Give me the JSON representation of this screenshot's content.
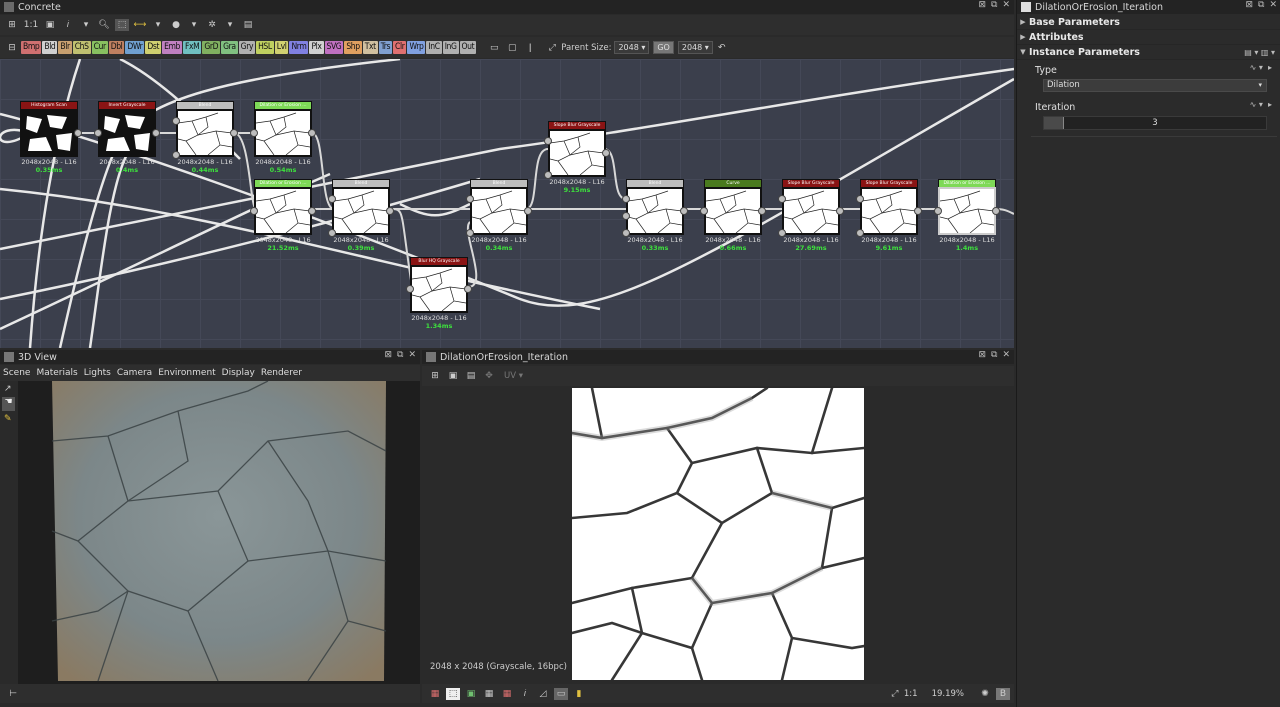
{
  "graph_panel": {
    "title": "Concrete",
    "toolbar": {
      "zoom_label": "1:1"
    },
    "filters": [
      "Bmp",
      "Bld",
      "Blr",
      "ChS",
      "Cur",
      "Dbl",
      "DWr",
      "Dst",
      "Emb",
      "FxM",
      "GrD",
      "Gra",
      "Gry",
      "HSL",
      "Lvl",
      "Nrm",
      "Plx",
      "SVG",
      "Shp",
      "Txt",
      "Trs",
      "Clr",
      "Wrp",
      "InC",
      "InG",
      "Out"
    ],
    "filter_colors": [
      "#d07070",
      "#d0d0d0",
      "#c8a070",
      "#c0c070",
      "#88c060",
      "#c08060",
      "#70a0d0",
      "#d0d070",
      "#c080c0",
      "#70c0c0",
      "#80b060",
      "#80c080",
      "#b0b0b0",
      "#c0d060",
      "#d0d070",
      "#8080e0",
      "#d0d0d0",
      "#c070c0",
      "#e0a060",
      "#d0c0a0",
      "#80a0d0",
      "#e07070",
      "#80a0e0",
      "#b0b0b0",
      "#b0b0b0",
      "#b0b0b0"
    ],
    "parent_size_label": "Parent Size:",
    "parent_size_value": "2048",
    "size_value": "2048",
    "link_label": "GO",
    "nodes": [
      {
        "title": "Histogram Scan",
        "header": "#8a1414",
        "res": "2048x2048 - L16",
        "time": "0.35ms"
      },
      {
        "title": "Invert Grayscale",
        "header": "#8a1414",
        "res": "2048x2048 - L16",
        "time": "0.4ms"
      },
      {
        "title": "Blend",
        "header": "#bdbdbd",
        "res": "2048x2048 - L16",
        "time": "0.44ms"
      },
      {
        "title": "Dilation or Erosion ...",
        "header": "#7ed957",
        "res": "2048x2048 - L16",
        "time": "0.54ms"
      },
      {
        "title": "Dilation or Erosion ...",
        "header": "#7ed957",
        "res": "2048x2048 - L16",
        "time": "21.52ms"
      },
      {
        "title": "Blend",
        "header": "#bdbdbd",
        "res": "2048x2048 - L16",
        "time": "0.39ms"
      },
      {
        "title": "Blend",
        "header": "#bdbdbd",
        "res": "2048x2048 - L16",
        "time": "0.34ms"
      },
      {
        "title": "Blur HQ Grayscale",
        "header": "#8a1414",
        "res": "2048x2048 - L16",
        "time": "1.34ms"
      },
      {
        "title": "Slope Blur Grayscale",
        "header": "#8a1414",
        "res": "2048x2048 - L16",
        "time": "9.15ms"
      },
      {
        "title": "Blend",
        "header": "#bdbdbd",
        "res": "2048x2048 - L16",
        "time": "0.33ms"
      },
      {
        "title": "Curve",
        "header": "#4a7a1e",
        "res": "2048x2048 - L16",
        "time": "0.66ms"
      },
      {
        "title": "Slope Blur Grayscale",
        "header": "#8a1414",
        "res": "2048x2048 - L16",
        "time": "27.69ms"
      },
      {
        "title": "Slope Blur Grayscale",
        "header": "#8a1414",
        "res": "2048x2048 - L16",
        "time": "9.61ms"
      },
      {
        "title": "Dilation or Erosion ...",
        "header": "#7ed957",
        "res": "2048x2048 - L16",
        "time": "1.4ms"
      }
    ]
  },
  "view3d": {
    "title": "3D View",
    "menu": [
      "Scene",
      "Materials",
      "Lights",
      "Camera",
      "Environment",
      "Display",
      "Renderer"
    ]
  },
  "view2d": {
    "title": "DilationOrErosion_Iteration",
    "uv_label": "UV",
    "info": "2048 x 2048 (Grayscale, 16bpc)",
    "zoom_ratio": "1:1",
    "zoom_percent": "19.19%"
  },
  "params": {
    "title": "DilationOrErosion_Iteration",
    "sections": [
      "Base Parameters",
      "Attributes",
      "Instance Parameters"
    ],
    "type_label": "Type",
    "type_value": "Dilation",
    "iteration_label": "Iteration",
    "iteration_value": "3"
  }
}
